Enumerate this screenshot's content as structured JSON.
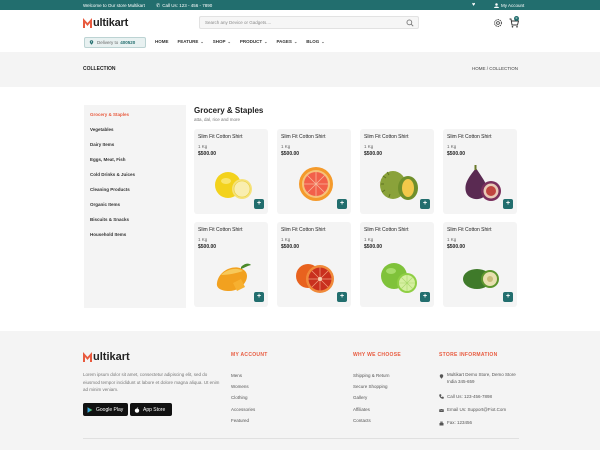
{
  "topbar": {
    "welcome": "Welcome to Our store Multikart",
    "call": "Call Us: 123 - 456 - 7890",
    "account": "My Account"
  },
  "header": {
    "logo_first": "M",
    "logo_rest": "ultikart",
    "search_placeholder": "Search any Device or Gadgets....",
    "cart_count": "0"
  },
  "delivery": {
    "label": "Delivery to",
    "code": "400520"
  },
  "nav": [
    "HOME",
    "FEATURE",
    "SHOP",
    "PRODUCT",
    "PAGES",
    "BLOG"
  ],
  "breadcrumb": {
    "title": "COLLECTION",
    "path": "HOME / COLLECTION"
  },
  "sidebar": {
    "items": [
      "Grocery & Staples",
      "Vegetables",
      "Dairy Items",
      "Eggs, Meat, Fish",
      "Cold Drinks & Juices",
      "Cleaning Products",
      "Organic Items",
      "Biscuits & Snacks",
      "Household Items"
    ],
    "active_index": 0
  },
  "main": {
    "title": "Grocery & Staples",
    "subtitle": "atta, dal, rice and more"
  },
  "products": [
    {
      "name": "Slim Fit Cotton Shirt",
      "qty": "1 Kg",
      "price": "$500.00",
      "fruit": "lemon-icon"
    },
    {
      "name": "Slim Fit Cotton Shirt",
      "qty": "1 Kg",
      "price": "$500.00",
      "fruit": "grapefruit-icon"
    },
    {
      "name": "Slim Fit Cotton Shirt",
      "qty": "1 Kg",
      "price": "$500.00",
      "fruit": "durian-icon"
    },
    {
      "name": "Slim Fit Cotton Shirt",
      "qty": "1 Kg",
      "price": "$500.00",
      "fruit": "fig-icon"
    },
    {
      "name": "Slim Fit Cotton Shirt",
      "qty": "1 Kg",
      "price": "$500.00",
      "fruit": "mango-icon"
    },
    {
      "name": "Slim Fit Cotton Shirt",
      "qty": "1 Kg",
      "price": "$500.00",
      "fruit": "blood-orange-icon"
    },
    {
      "name": "Slim Fit Cotton Shirt",
      "qty": "1 Kg",
      "price": "$500.00",
      "fruit": "lime-icon"
    },
    {
      "name": "Slim Fit Cotton Shirt",
      "qty": "1 Kg",
      "price": "$500.00",
      "fruit": "feijoa-icon"
    }
  ],
  "add_label": "+",
  "footer": {
    "about": "Lorem ipsum dolor sit amet, consectetur adipiscing elit, sed do eiusmod tempor incididunt ut labore et dolore magna aliqua. Ut enim ad minim veniam.",
    "google_play": "Google Play",
    "app_store": "App Store",
    "my_account": {
      "heading": "MY ACCOUNT",
      "links": [
        "Mens",
        "Womens",
        "Clothing",
        "Accessories",
        "Featured"
      ]
    },
    "why_choose": {
      "heading": "WHY WE CHOOSE",
      "links": [
        "Shipping & Return",
        "Secure Shopping",
        "Gallery",
        "Affiliates",
        "Contacts"
      ]
    },
    "store_info": {
      "heading": "STORE INFORMATION",
      "address": "Multikart Demo Store, Demo Store India 345-659",
      "call": "Call Us: 123-456-7898",
      "email": "Email Us: Support@Fiot.Com",
      "fax": "Fax: 123456"
    }
  },
  "colors": {
    "teal": "#226e6e",
    "accent": "#e85a3e",
    "panel": "#f4f4f4"
  }
}
